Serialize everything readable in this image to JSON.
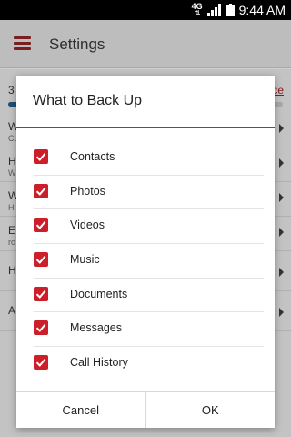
{
  "status_bar": {
    "network": "4G",
    "network_arrows": "⇅",
    "time": "9:44 AM"
  },
  "app_bar": {
    "title": "Settings"
  },
  "background": {
    "progress_label": "3",
    "progress_link": "ce",
    "progress_fraction": 0.04,
    "rows": [
      {
        "title": "W",
        "subtitle": "Co"
      },
      {
        "title": "H",
        "subtitle": "W"
      },
      {
        "title": "W",
        "subtitle": "Hi"
      },
      {
        "title": "E",
        "subtitle": "ro"
      },
      {
        "title": "H",
        "subtitle": ""
      },
      {
        "title": "A",
        "subtitle": ""
      }
    ]
  },
  "dialog": {
    "title": "What to Back Up",
    "options": [
      {
        "label": "Contacts",
        "checked": true
      },
      {
        "label": "Photos",
        "checked": true
      },
      {
        "label": "Videos",
        "checked": true
      },
      {
        "label": "Music",
        "checked": true
      },
      {
        "label": "Documents",
        "checked": true
      },
      {
        "label": "Messages",
        "checked": true
      },
      {
        "label": "Call History",
        "checked": true
      }
    ],
    "cancel_label": "Cancel",
    "ok_label": "OK"
  },
  "colors": {
    "accent": "#cc1f2a",
    "scrim": "#c3c3c3"
  }
}
